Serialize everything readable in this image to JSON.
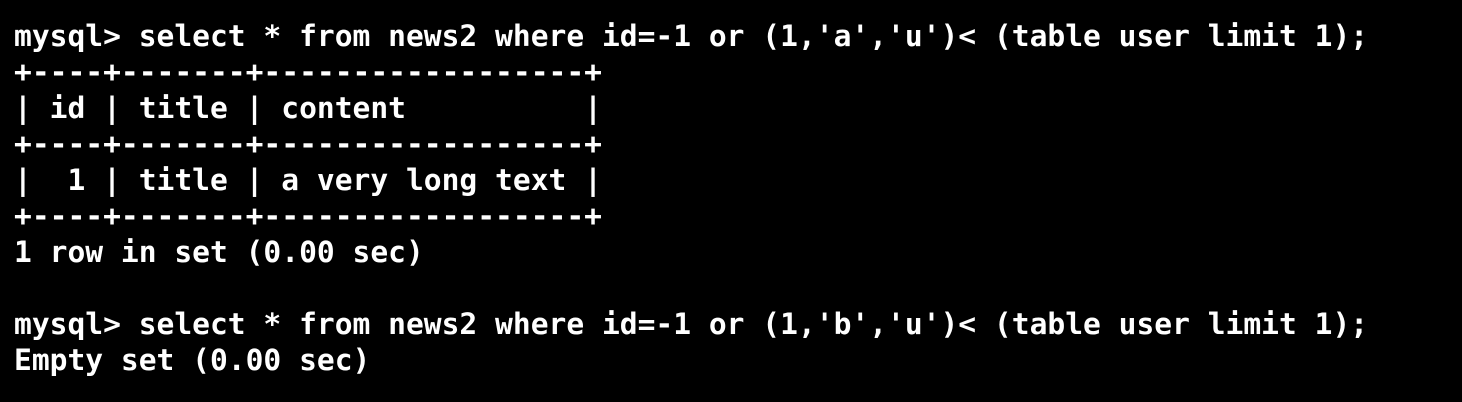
{
  "terminal": {
    "lines": [
      "mysql> select * from news2 where id=-1 or (1,'a','u')< (table user limit 1);",
      "+----+-------+------------------+",
      "| id | title | content          |",
      "+----+-------+------------------+",
      "|  1 | title | a very long text |",
      "+----+-------+------------------+",
      "1 row in set (0.00 sec)",
      "",
      "mysql> select * from news2 where id=-1 or (1,'b','u')< (table user limit 1);",
      "Empty set (0.00 sec)"
    ]
  },
  "colors": {
    "background": "#000000",
    "foreground": "#ffffff"
  }
}
